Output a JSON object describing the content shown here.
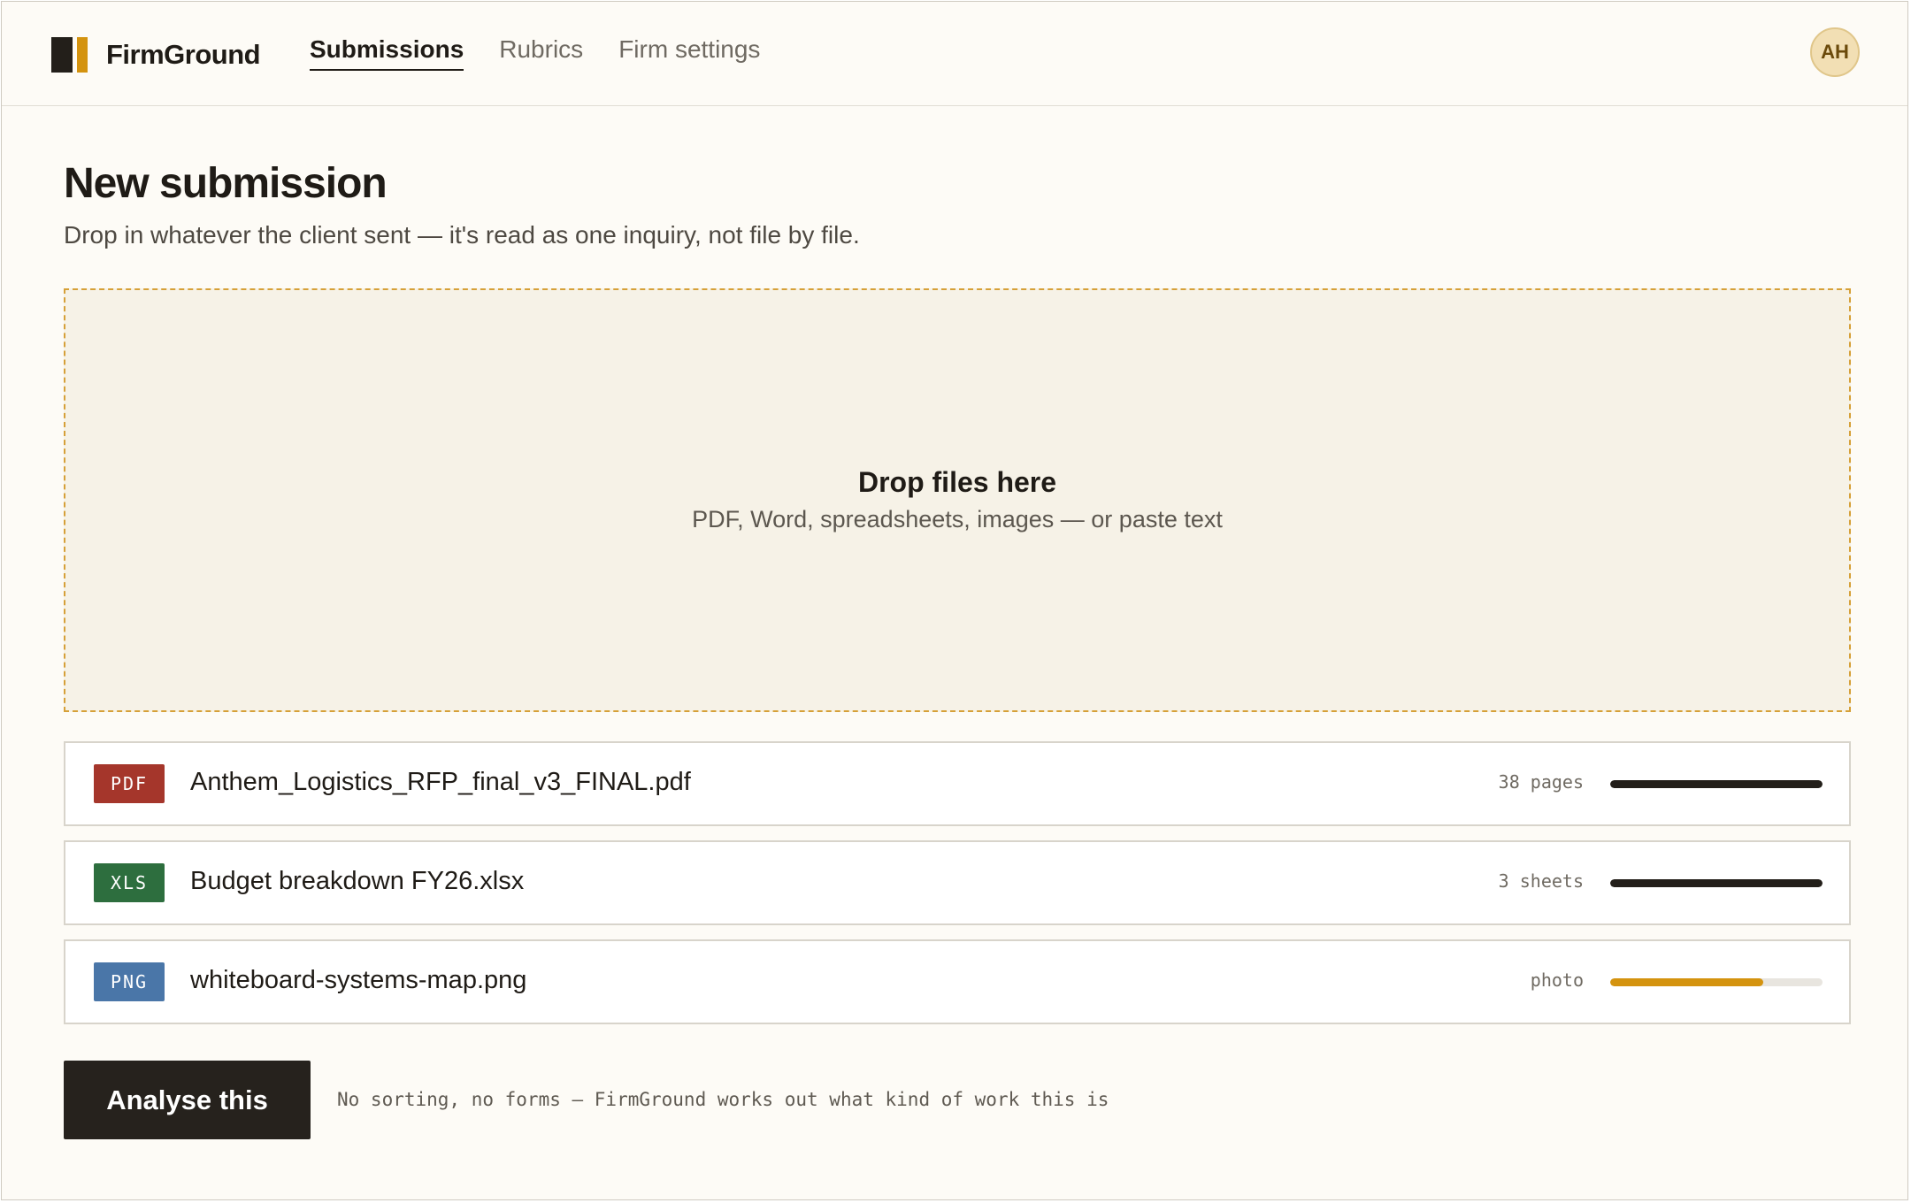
{
  "app": {
    "name": "FirmGround",
    "colors": {
      "accent": "#d4930f",
      "dark": "#231f1a",
      "background": "#fdfbf6"
    }
  },
  "nav": {
    "items": [
      {
        "label": "Submissions",
        "active": true
      },
      {
        "label": "Rubrics",
        "active": false
      },
      {
        "label": "Firm settings",
        "active": false
      }
    ]
  },
  "user": {
    "initials": "AH"
  },
  "page": {
    "title": "New submission",
    "subtitle": "Drop in whatever the client sent — it's read as one inquiry, not file by file."
  },
  "dropzone": {
    "title": "Drop files here",
    "hint": "PDF, Word, spreadsheets, images — or paste text"
  },
  "files": [
    {
      "type": "PDF",
      "type_color": "#a5362b",
      "name": "Anthem_Logistics_RFP_final_v3_FINAL.pdf",
      "meta": "38 pages",
      "progress": 1.0,
      "progress_color": "#231f1a"
    },
    {
      "type": "XLS",
      "type_color": "#2d6e3e",
      "name": "Budget breakdown FY26.xlsx",
      "meta": "3 sheets",
      "progress": 1.0,
      "progress_color": "#231f1a"
    },
    {
      "type": "PNG",
      "type_color": "#4a76a8",
      "name": "whiteboard-systems-map.png",
      "meta": "photo",
      "progress": 0.72,
      "progress_color": "#d4930f"
    }
  ],
  "actions": {
    "analyse_label": "Analyse this",
    "note": "No sorting, no forms — FirmGround works out what kind of work this is"
  }
}
